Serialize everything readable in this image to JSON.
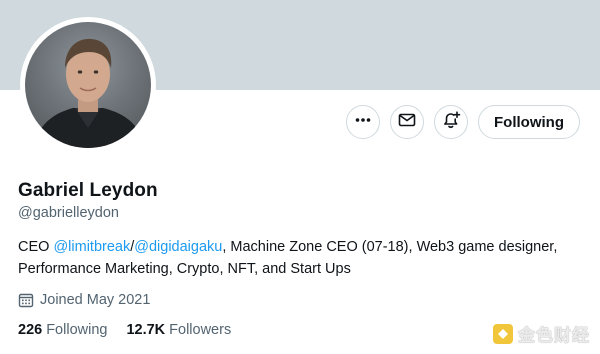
{
  "profile": {
    "name": "Gabriel Leydon",
    "handle": "@gabrielleydon",
    "bio": {
      "prefix": "CEO ",
      "mention1": "@limitbreak",
      "separator": "/",
      "mention2": "@digidaigaku",
      "suffix": ", Machine Zone CEO (07-18), Web3 game designer,",
      "line2": "Performance Marketing, Crypto, NFT, and Start Ups"
    },
    "joined": "Joined May 2021",
    "following_count": "226",
    "following_label": "Following",
    "followers_count": "12.7K",
    "followers_label": "Followers"
  },
  "actions": {
    "more_icon": "more-dots-icon",
    "message_icon": "envelope-icon",
    "notify_icon": "bell-plus-icon",
    "follow_label": "Following"
  },
  "watermark": {
    "text": "金色财经"
  },
  "colors": {
    "banner": "#cfd9de",
    "accent": "#1d9bf0",
    "secondary_text": "#536471",
    "primary_text": "#0f1419"
  }
}
